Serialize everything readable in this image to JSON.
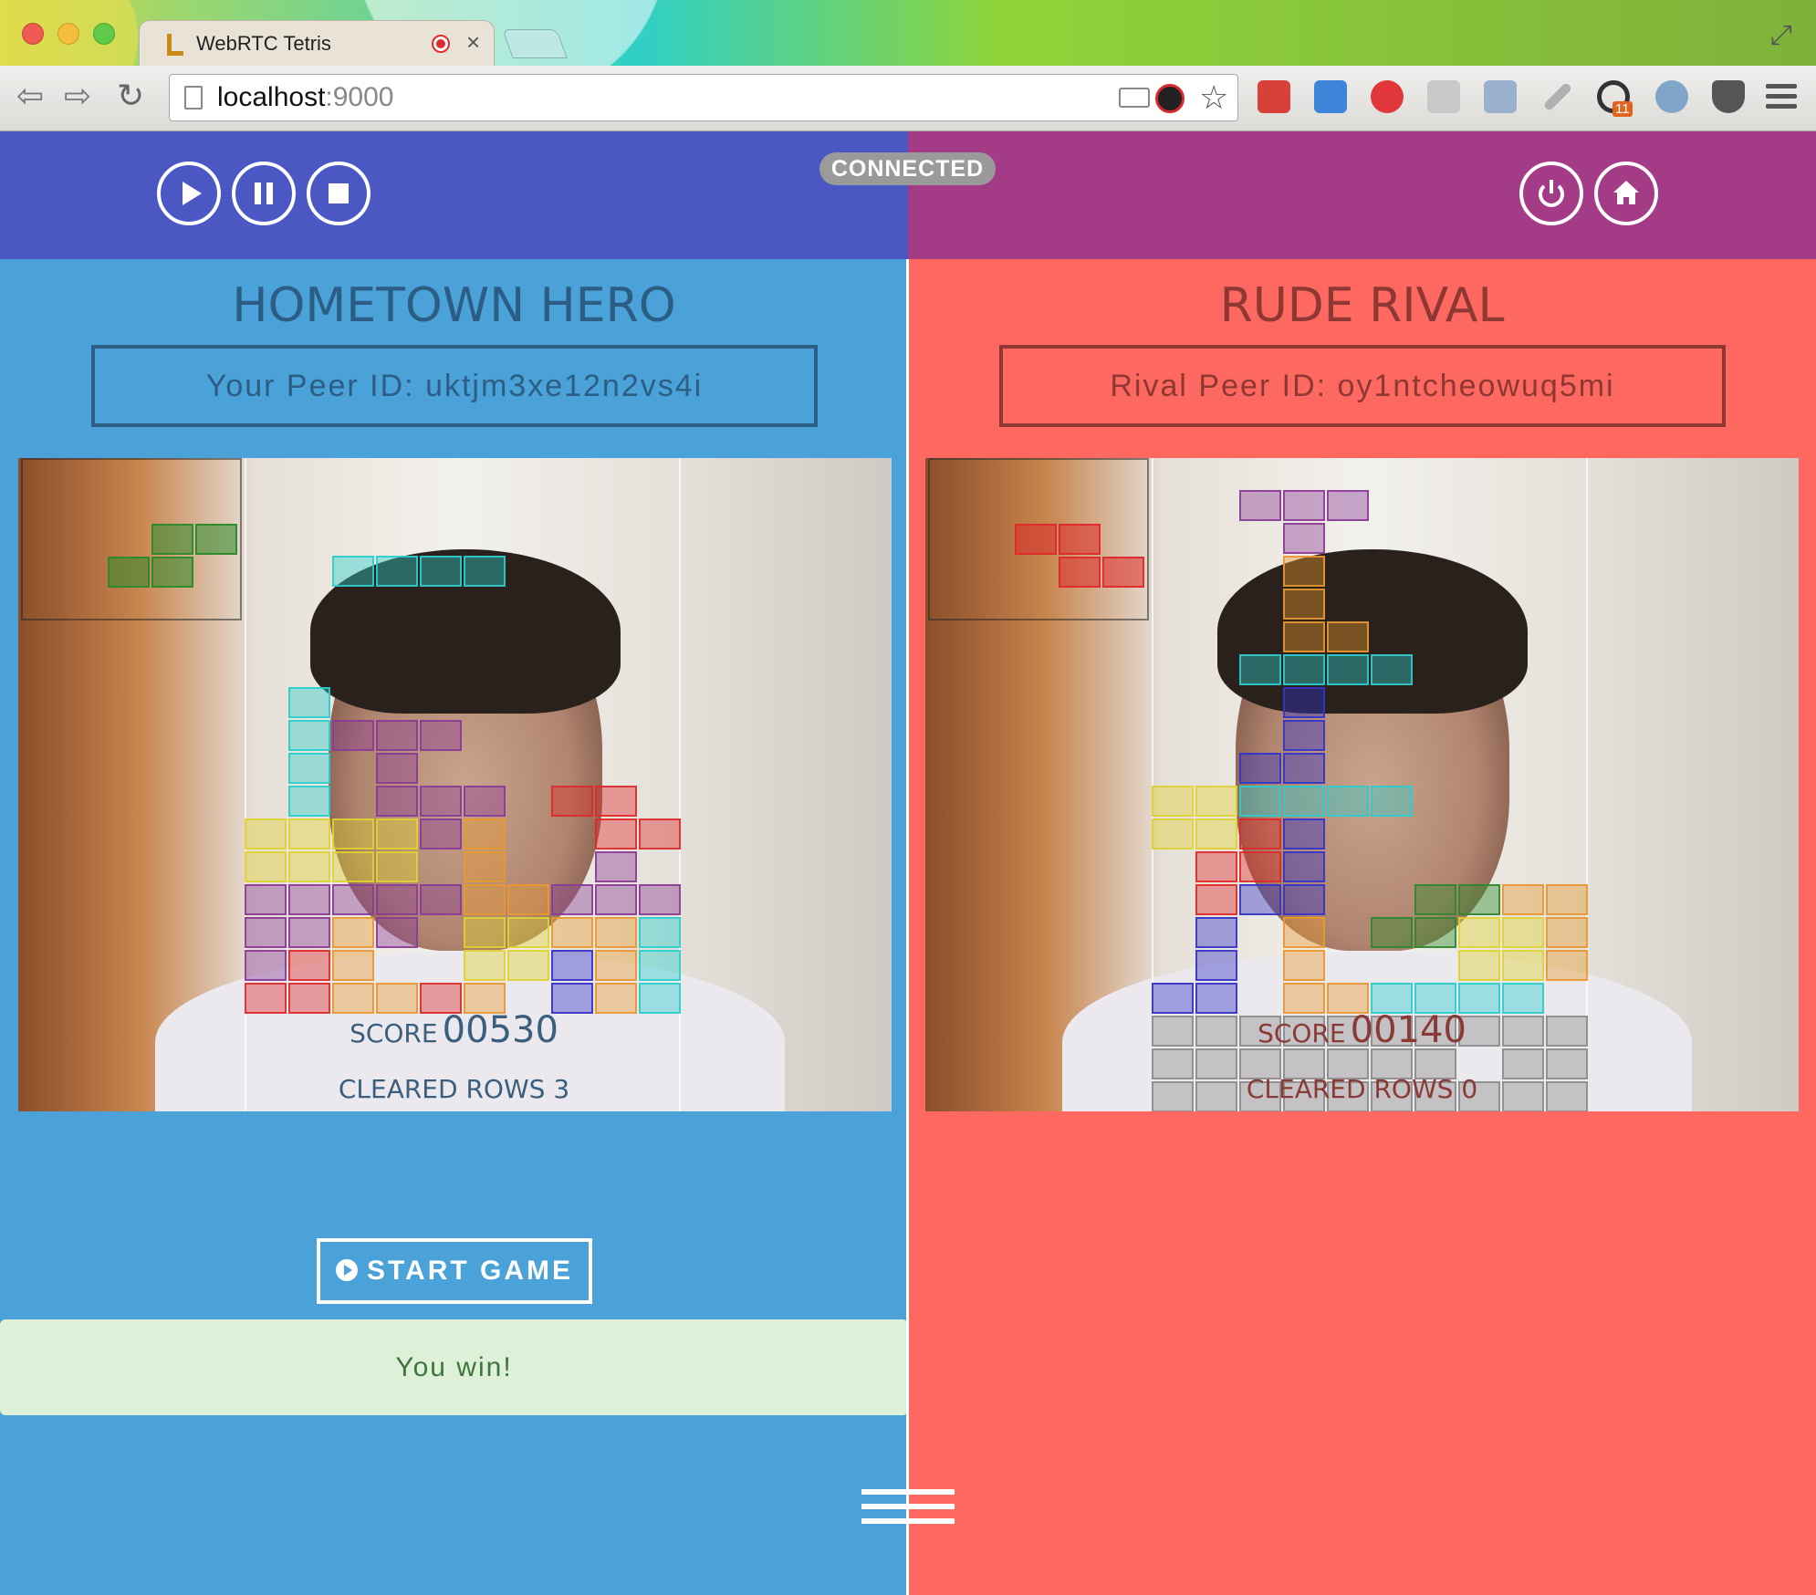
{
  "browser": {
    "tab_title": "WebRTC Tetris",
    "url_host": "localhost",
    "url_port": ":9000",
    "extension_badge": "11"
  },
  "header": {
    "status_badge": "CONNECTED",
    "left_controls": [
      "play-icon",
      "pause-icon",
      "stop-icon"
    ],
    "right_controls": [
      "power-icon",
      "home-icon"
    ],
    "left_color": "#4b58c4",
    "right_color": "#a33b87"
  },
  "local": {
    "title": "HOMETOWN HERO",
    "peer_id": "Your Peer ID: uktjm3xe12n2vs4i",
    "score_label": "SCORE",
    "score": "00530",
    "cleared_rows": "CLEARED ROWS 3",
    "start_button": "START GAME",
    "message": "You win!",
    "bg_color": "#4ba2d9"
  },
  "rival": {
    "title": "RUDE RIVAL",
    "peer_id": "Rival Peer ID: oy1ntcheowuq5mi",
    "score_label": "SCORE",
    "score": "00140",
    "cleared_rows": "CLEARED ROWS 0",
    "bg_color": "#fd6860"
  },
  "colors": {
    "cyan": "#2ccccc",
    "purple": "#8a3b96",
    "yellow": "#e0d232",
    "orange": "#e8982f",
    "red": "#dd2a2a",
    "blue": "#3434c8",
    "green": "#2c8a2c",
    "gray": "#8c8c8c"
  },
  "local_board": {
    "next_piece": {
      "color": "green",
      "cells": [
        [
          2,
          0
        ],
        [
          3,
          0
        ],
        [
          1,
          1
        ],
        [
          2,
          1
        ]
      ]
    },
    "cells": [
      [
        2,
        3,
        "cyan"
      ],
      [
        3,
        3,
        "cyan"
      ],
      [
        4,
        3,
        "cyan"
      ],
      [
        5,
        3,
        "cyan"
      ],
      [
        1,
        7,
        "cyan"
      ],
      [
        1,
        8,
        "cyan"
      ],
      [
        1,
        9,
        "cyan"
      ],
      [
        1,
        10,
        "cyan"
      ],
      [
        2,
        8,
        "purple"
      ],
      [
        3,
        8,
        "purple"
      ],
      [
        4,
        8,
        "purple"
      ],
      [
        3,
        9,
        "purple"
      ],
      [
        3,
        10,
        "purple"
      ],
      [
        4,
        10,
        "purple"
      ],
      [
        5,
        10,
        "purple"
      ],
      [
        4,
        11,
        "purple"
      ],
      [
        7,
        10,
        "red"
      ],
      [
        8,
        10,
        "red"
      ],
      [
        8,
        11,
        "red"
      ],
      [
        9,
        11,
        "red"
      ],
      [
        0,
        11,
        "yellow"
      ],
      [
        1,
        11,
        "yellow"
      ],
      [
        2,
        11,
        "yellow"
      ],
      [
        3,
        11,
        "yellow"
      ],
      [
        0,
        12,
        "yellow"
      ],
      [
        1,
        12,
        "yellow"
      ],
      [
        2,
        12,
        "yellow"
      ],
      [
        3,
        12,
        "yellow"
      ],
      [
        5,
        11,
        "orange"
      ],
      [
        5,
        12,
        "orange"
      ],
      [
        8,
        12,
        "purple"
      ],
      [
        0,
        13,
        "purple"
      ],
      [
        1,
        13,
        "purple"
      ],
      [
        2,
        13,
        "purple"
      ],
      [
        3,
        13,
        "purple"
      ],
      [
        4,
        13,
        "purple"
      ],
      [
        5,
        13,
        "orange"
      ],
      [
        6,
        13,
        "orange"
      ],
      [
        7,
        13,
        "purple"
      ],
      [
        8,
        13,
        "purple"
      ],
      [
        9,
        13,
        "purple"
      ],
      [
        0,
        14,
        "purple"
      ],
      [
        1,
        14,
        "purple"
      ],
      [
        2,
        14,
        "orange"
      ],
      [
        3,
        14,
        "purple"
      ],
      [
        5,
        14,
        "yellow"
      ],
      [
        6,
        14,
        "yellow"
      ],
      [
        7,
        14,
        "orange"
      ],
      [
        8,
        14,
        "orange"
      ],
      [
        9,
        14,
        "cyan"
      ],
      [
        0,
        15,
        "purple"
      ],
      [
        1,
        15,
        "red"
      ],
      [
        2,
        15,
        "orange"
      ],
      [
        5,
        15,
        "yellow"
      ],
      [
        6,
        15,
        "yellow"
      ],
      [
        7,
        15,
        "blue"
      ],
      [
        8,
        15,
        "orange"
      ],
      [
        9,
        15,
        "cyan"
      ],
      [
        0,
        16,
        "red"
      ],
      [
        1,
        16,
        "red"
      ],
      [
        2,
        16,
        "orange"
      ],
      [
        3,
        16,
        "orange"
      ],
      [
        4,
        16,
        "red"
      ],
      [
        5,
        16,
        "orange"
      ],
      [
        7,
        16,
        "blue"
      ],
      [
        8,
        16,
        "orange"
      ],
      [
        9,
        16,
        "cyan"
      ]
    ]
  },
  "rival_board": {
    "next_piece": {
      "color": "red",
      "cells": [
        [
          1,
          0
        ],
        [
          2,
          0
        ],
        [
          2,
          1
        ],
        [
          3,
          1
        ]
      ]
    },
    "cells": [
      [
        2,
        1,
        "purple"
      ],
      [
        3,
        1,
        "purple"
      ],
      [
        4,
        1,
        "purple"
      ],
      [
        3,
        2,
        "purple"
      ],
      [
        3,
        3,
        "orange"
      ],
      [
        3,
        4,
        "orange"
      ],
      [
        3,
        5,
        "orange"
      ],
      [
        4,
        5,
        "orange"
      ],
      [
        2,
        6,
        "cyan"
      ],
      [
        3,
        6,
        "cyan"
      ],
      [
        4,
        6,
        "cyan"
      ],
      [
        5,
        6,
        "cyan"
      ],
      [
        3,
        7,
        "blue"
      ],
      [
        3,
        8,
        "blue"
      ],
      [
        2,
        9,
        "blue"
      ],
      [
        3,
        9,
        "blue"
      ],
      [
        0,
        10,
        "yellow"
      ],
      [
        1,
        10,
        "yellow"
      ],
      [
        2,
        10,
        "cyan"
      ],
      [
        3,
        10,
        "cyan"
      ],
      [
        4,
        10,
        "cyan"
      ],
      [
        5,
        10,
        "cyan"
      ],
      [
        0,
        11,
        "yellow"
      ],
      [
        1,
        11,
        "yellow"
      ],
      [
        2,
        11,
        "red"
      ],
      [
        3,
        11,
        "blue"
      ],
      [
        1,
        12,
        "red"
      ],
      [
        2,
        12,
        "red"
      ],
      [
        3,
        12,
        "blue"
      ],
      [
        1,
        13,
        "red"
      ],
      [
        2,
        13,
        "blue"
      ],
      [
        3,
        13,
        "blue"
      ],
      [
        6,
        13,
        "green"
      ],
      [
        7,
        13,
        "green"
      ],
      [
        8,
        13,
        "orange"
      ],
      [
        9,
        13,
        "orange"
      ],
      [
        1,
        14,
        "blue"
      ],
      [
        3,
        14,
        "orange"
      ],
      [
        5,
        14,
        "green"
      ],
      [
        6,
        14,
        "green"
      ],
      [
        7,
        14,
        "yellow"
      ],
      [
        8,
        14,
        "yellow"
      ],
      [
        9,
        14,
        "orange"
      ],
      [
        1,
        15,
        "blue"
      ],
      [
        3,
        15,
        "orange"
      ],
      [
        7,
        15,
        "yellow"
      ],
      [
        8,
        15,
        "yellow"
      ],
      [
        9,
        15,
        "orange"
      ],
      [
        0,
        16,
        "blue"
      ],
      [
        1,
        16,
        "blue"
      ],
      [
        3,
        16,
        "orange"
      ],
      [
        4,
        16,
        "orange"
      ],
      [
        5,
        16,
        "cyan"
      ],
      [
        6,
        16,
        "cyan"
      ],
      [
        7,
        16,
        "cyan"
      ],
      [
        8,
        16,
        "cyan"
      ],
      [
        0,
        17,
        "gray"
      ],
      [
        1,
        17,
        "gray"
      ],
      [
        2,
        17,
        "gray"
      ],
      [
        3,
        17,
        "gray"
      ],
      [
        4,
        17,
        "gray"
      ],
      [
        5,
        17,
        "gray"
      ],
      [
        6,
        17,
        "gray"
      ],
      [
        7,
        17,
        "gray"
      ],
      [
        8,
        17,
        "gray"
      ],
      [
        9,
        17,
        "gray"
      ],
      [
        0,
        18,
        "gray"
      ],
      [
        1,
        18,
        "gray"
      ],
      [
        2,
        18,
        "gray"
      ],
      [
        3,
        18,
        "gray"
      ],
      [
        4,
        18,
        "gray"
      ],
      [
        5,
        18,
        "gray"
      ],
      [
        6,
        18,
        "gray"
      ],
      [
        8,
        18,
        "gray"
      ],
      [
        9,
        18,
        "gray"
      ],
      [
        0,
        19,
        "gray"
      ],
      [
        1,
        19,
        "gray"
      ],
      [
        2,
        19,
        "gray"
      ],
      [
        3,
        19,
        "gray"
      ],
      [
        4,
        19,
        "gray"
      ],
      [
        5,
        19,
        "gray"
      ],
      [
        6,
        19,
        "gray"
      ],
      [
        7,
        19,
        "gray"
      ],
      [
        8,
        19,
        "gray"
      ],
      [
        9,
        19,
        "gray"
      ]
    ]
  }
}
